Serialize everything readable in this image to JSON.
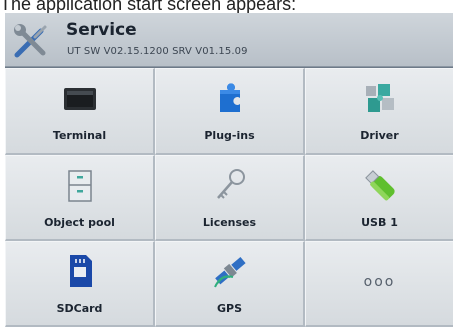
{
  "caption": "The application start screen appears:",
  "header": {
    "title": "Service",
    "subtitle": "UT SW V02.15.1200 SRV V01.15.09",
    "icon": "wrench-screwdriver-icon"
  },
  "tiles": [
    {
      "label": "Terminal",
      "icon": "terminal-display-icon"
    },
    {
      "label": "Plug-ins",
      "icon": "puzzle-piece-icon"
    },
    {
      "label": "Driver",
      "icon": "puzzle-pieces-icon"
    },
    {
      "label": "Object pool",
      "icon": "filing-cabinet-icon"
    },
    {
      "label": "Licenses",
      "icon": "key-icon"
    },
    {
      "label": "USB 1",
      "icon": "usb-stick-icon"
    },
    {
      "label": "SDCard",
      "icon": "sd-card-icon"
    },
    {
      "label": "GPS",
      "icon": "satellite-icon"
    },
    {
      "label": "ooo",
      "icon": "more-dots-icon"
    }
  ],
  "colors": {
    "header_bg": "#c4cbd2",
    "tile_bg": "#e0e4e8",
    "frame": "#6d7a88",
    "text": "#1b2430"
  }
}
